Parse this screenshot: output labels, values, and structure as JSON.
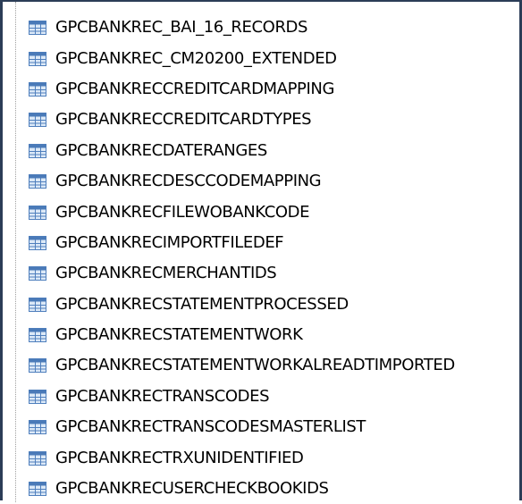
{
  "tree": {
    "items": [
      {
        "label": "GPCBANKREC_BAI_16_RECORDS",
        "icon": "table-icon"
      },
      {
        "label": "GPCBANKREC_CM20200_EXTENDED",
        "icon": "table-icon"
      },
      {
        "label": "GPCBANKRECCREDITCARDMAPPING",
        "icon": "table-icon"
      },
      {
        "label": "GPCBANKRECCREDITCARDTYPES",
        "icon": "table-icon"
      },
      {
        "label": "GPCBANKRECDATERANGES",
        "icon": "table-icon"
      },
      {
        "label": "GPCBANKRECDESCCODEMAPPING",
        "icon": "table-icon"
      },
      {
        "label": "GPCBANKRECFILEWOBANKCODE",
        "icon": "table-icon"
      },
      {
        "label": "GPCBANKRECIMPORTFILEDEF",
        "icon": "table-icon"
      },
      {
        "label": "GPCBANKRECMERCHANTIDS",
        "icon": "table-icon"
      },
      {
        "label": "GPCBANKRECSTATEMENTPROCESSED",
        "icon": "table-icon"
      },
      {
        "label": "GPCBANKRECSTATEMENTWORK",
        "icon": "table-icon"
      },
      {
        "label": "GPCBANKRECSTATEMENTWORKALREADTIMPORTED",
        "icon": "table-icon"
      },
      {
        "label": "GPCBANKRECTRANSCODES",
        "icon": "table-icon"
      },
      {
        "label": "GPCBANKRECTRANSCODESMASTERLIST",
        "icon": "table-icon"
      },
      {
        "label": "GPCBANKRECTRXUNIDENTIFIED",
        "icon": "table-icon"
      },
      {
        "label": "GPCBANKRECUSERCHECKBOOKIDS",
        "icon": "table-icon"
      }
    ]
  },
  "colors": {
    "frame": "#2b3d57",
    "icon_header": "#4a7ab8",
    "icon_body": "#dce9f7",
    "icon_border": "#4f7fbd",
    "text": "#000000"
  }
}
